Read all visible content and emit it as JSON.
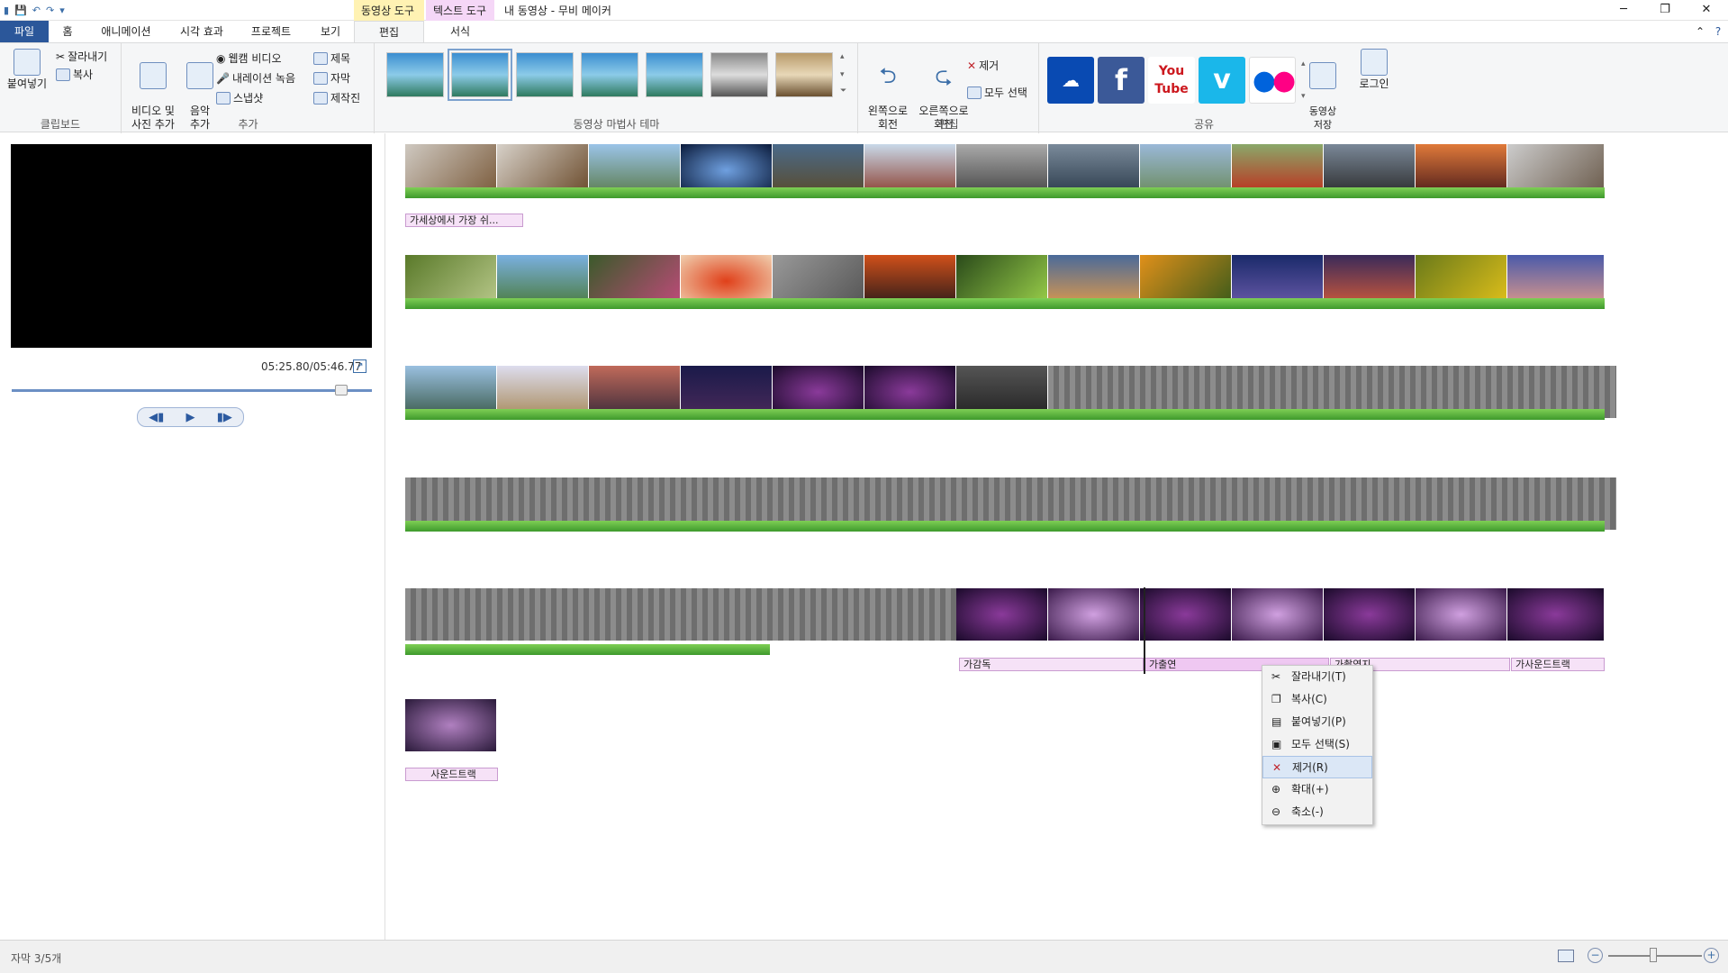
{
  "window": {
    "title": "내 동영상 - 무비 메이커",
    "ctx_video": "동영상 도구",
    "ctx_text": "텍스트 도구",
    "minimize": "─",
    "restore": "❐",
    "close": "✕"
  },
  "tabs": [
    "파일",
    "홈",
    "애니메이션",
    "시각 효과",
    "프로젝트",
    "보기",
    "편집",
    "서식"
  ],
  "ribbon": {
    "clipboard": {
      "paste": "붙여넣기",
      "cut": "잘라내기",
      "copy": "복사",
      "label": "클립보드"
    },
    "add": {
      "video_photo": "비디오 및\n사진 추가",
      "music": "음악\n추가",
      "webcam": "웹캠 비디오",
      "narration": "내레이션 녹음",
      "snapshot": "스냅샷",
      "title": "제목",
      "caption": "자막",
      "credits": "제작진",
      "label": "추가"
    },
    "themes": {
      "label": "동영상 마법사 테마"
    },
    "edit": {
      "rotate_left": "왼쪽으로\n회전",
      "rotate_right": "오른쪽으로\n회전",
      "remove": "제거",
      "select_all": "모두 선택",
      "label": "편집"
    },
    "share": {
      "save": "동영상\n저장",
      "login": "로그인",
      "label": "공유",
      "icons": [
        "onedrive-icon",
        "facebook-icon",
        "youtube-icon",
        "vimeo-icon",
        "flickr-icon"
      ]
    }
  },
  "preview": {
    "time": "05:25.80/05:46.77"
  },
  "captions": {
    "row1": "가세상에서 가장 쉬...",
    "row5a": "가감독",
    "row5b": "가출연",
    "row5c": "가촬영지",
    "row5d": "가사운드트랙",
    "row6": "사운드트랙"
  },
  "context_menu": [
    {
      "label": "잘라내기(T)",
      "icon": "scissors-icon"
    },
    {
      "label": "복사(C)",
      "icon": "copy-icon"
    },
    {
      "label": "붙여넣기(P)",
      "icon": "paste-icon"
    },
    {
      "label": "모두 선택(S)",
      "icon": "select-all-icon"
    },
    {
      "label": "제거(R)",
      "icon": "remove-icon"
    },
    {
      "label": "확대(+)",
      "icon": "zoom-in-icon"
    },
    {
      "label": "축소(-)",
      "icon": "zoom-out-icon"
    }
  ],
  "status": {
    "text": "자막 3/5개"
  },
  "colors": {
    "file_tab": "#2b579a",
    "ctx_video": "#fff2b3",
    "ctx_text": "#f5d7f7",
    "grass": "#4caf34",
    "caption_bg": "#f6e2f7"
  }
}
